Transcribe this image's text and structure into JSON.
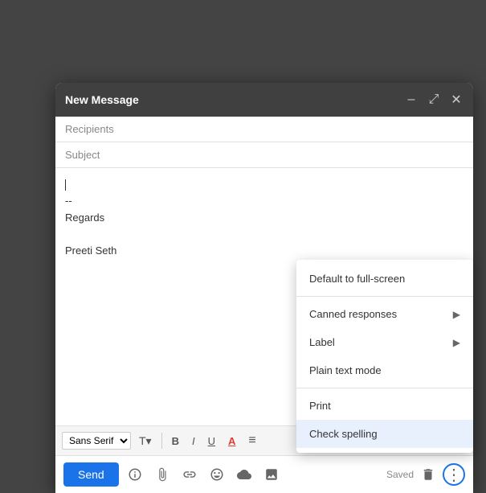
{
  "header": {
    "title": "New Message",
    "minimize_label": "–",
    "expand_label": "⤢",
    "close_label": "✕"
  },
  "fields": {
    "recipients_placeholder": "Recipients",
    "subject_placeholder": "Subject"
  },
  "body": {
    "cursor_text": "|",
    "signature_line1": "--",
    "signature_line2": "Regards",
    "signature_line3": "",
    "signature_line4": "Preeti Seth"
  },
  "toolbar": {
    "font_family": "Sans Serif",
    "font_size_icon": "T",
    "bold": "B",
    "italic": "I",
    "underline": "U",
    "text_color": "A",
    "align": "≡"
  },
  "footer": {
    "send_label": "Send",
    "saved_text": "Saved"
  },
  "dropdown": {
    "items": [
      {
        "label": "Default to full-screen",
        "has_arrow": false,
        "highlighted": false
      },
      {
        "label": "divider",
        "has_arrow": false,
        "highlighted": false
      },
      {
        "label": "Canned responses",
        "has_arrow": true,
        "highlighted": false
      },
      {
        "label": "Label",
        "has_arrow": true,
        "highlighted": false
      },
      {
        "label": "Plain text mode",
        "has_arrow": false,
        "highlighted": false
      },
      {
        "label": "divider2",
        "has_arrow": false,
        "highlighted": false
      },
      {
        "label": "Print",
        "has_arrow": false,
        "highlighted": false
      },
      {
        "label": "Check spelling",
        "has_arrow": false,
        "highlighted": true
      }
    ]
  }
}
